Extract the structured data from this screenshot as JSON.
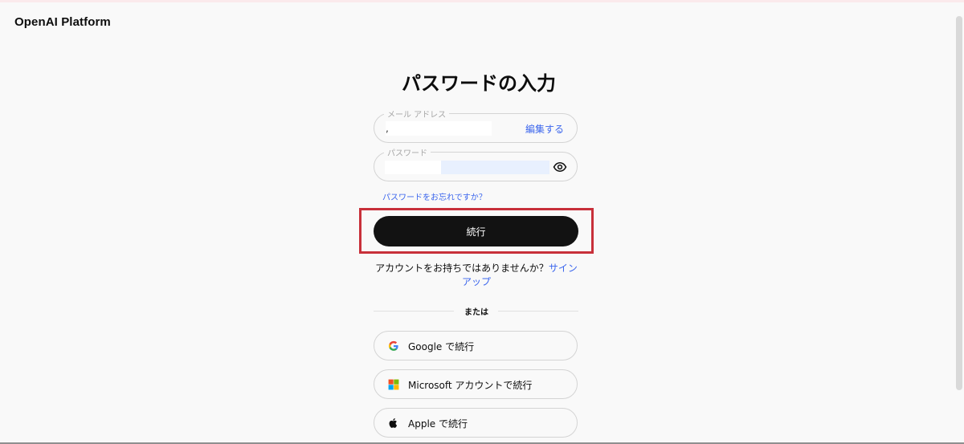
{
  "brand": {
    "name": "OpenAI  Platform"
  },
  "heading": "パスワードの入力",
  "email_field": {
    "label": "メール アドレス",
    "value": ",",
    "edit_label": "編集する"
  },
  "password_field": {
    "label": "パスワード"
  },
  "forgot_password": "パスワードをお忘れですか？",
  "continue_button": "続行",
  "signup": {
    "prompt": "アカウントをお持ちではありませんか？",
    "link": "サインアップ"
  },
  "divider": "または",
  "social": {
    "google": "Google で続行",
    "microsoft": "Microsoft アカウントで続行",
    "apple": "Apple で続行"
  },
  "colors": {
    "link": "#3c66ed",
    "button": "#121212",
    "highlight": "#c8303a",
    "autofill": "#e8f0fe"
  }
}
